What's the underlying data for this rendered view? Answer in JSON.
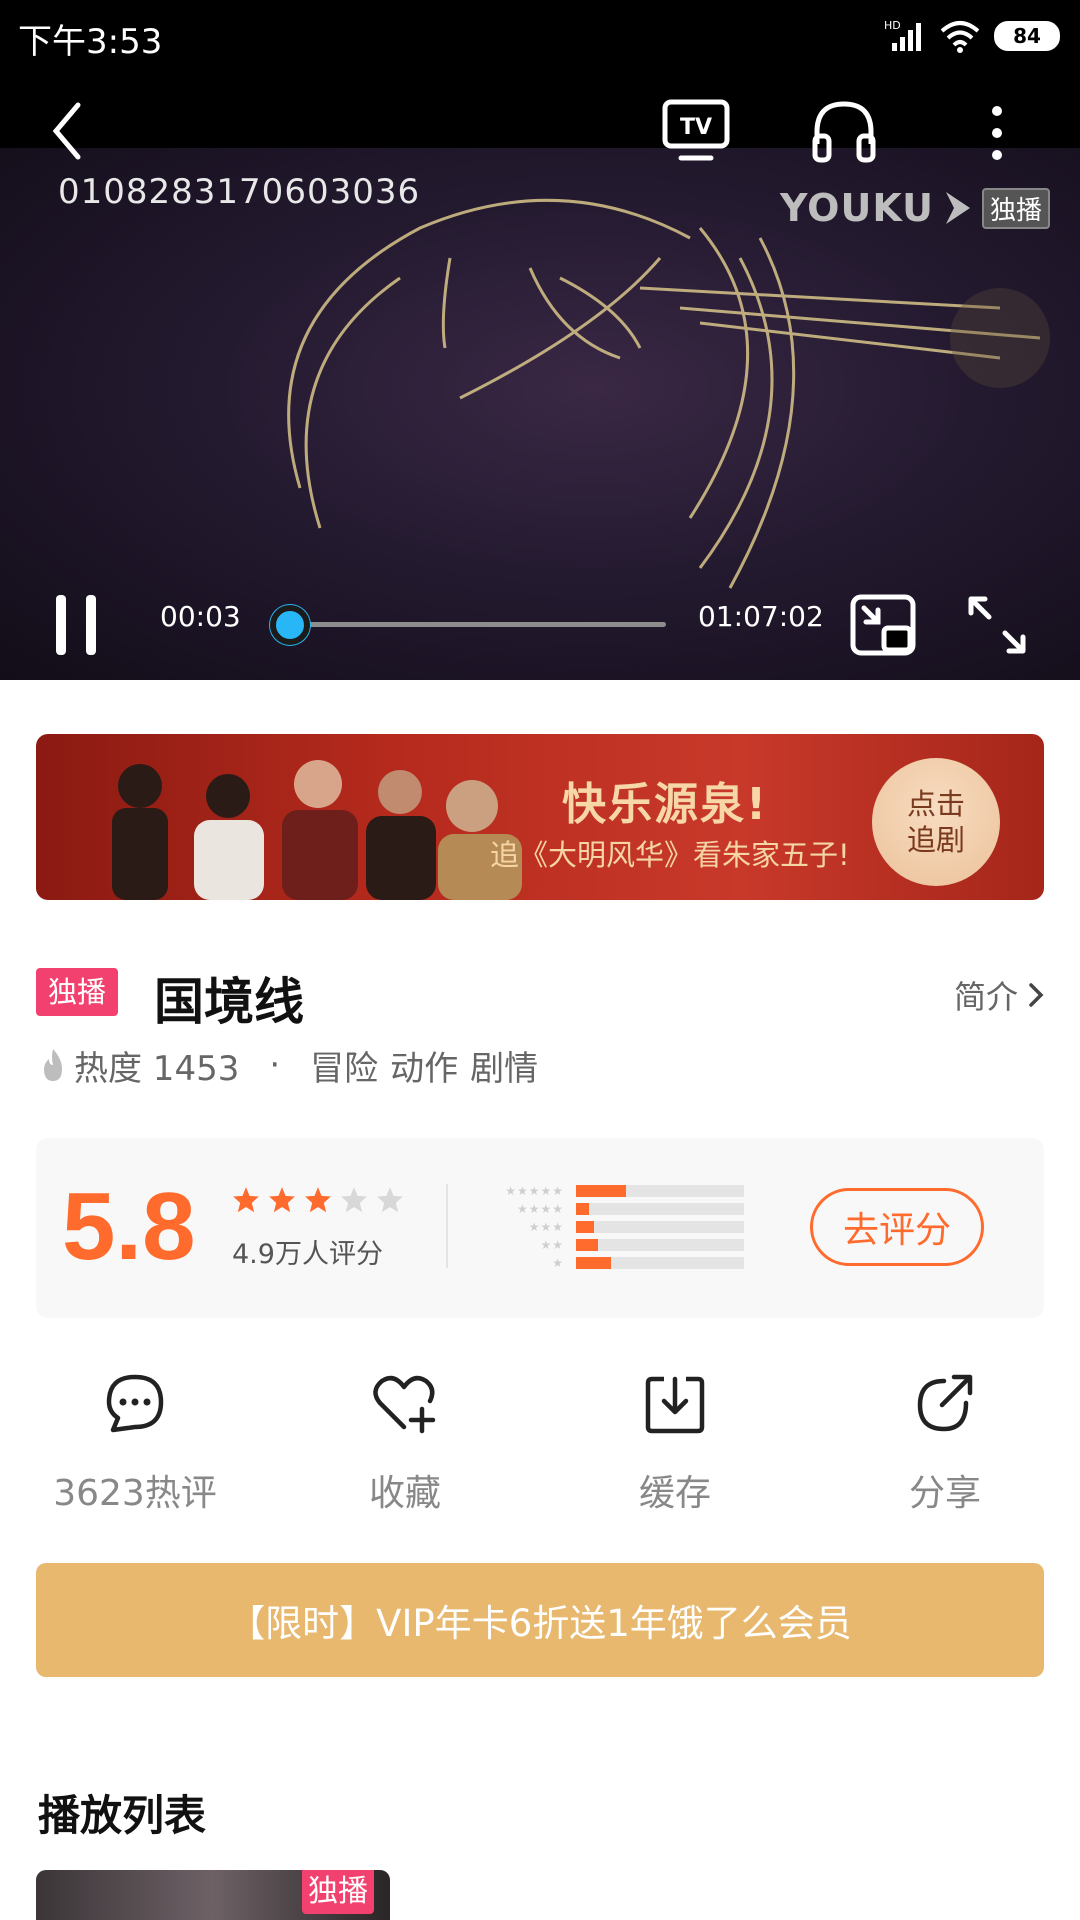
{
  "status_bar": {
    "time": "下午3:53",
    "battery": "84",
    "network_badge": "HD"
  },
  "player": {
    "video_id": "0108283170603036",
    "logo_text": "YOUKU",
    "logo_badge": "独播",
    "tv_icon_label": "TV",
    "current_time": "00:03",
    "total_time": "01:07:02",
    "progress_fraction": 0.0007,
    "state": "playing",
    "progress_color": "#29b6f6"
  },
  "banner": {
    "title": "快乐源泉!",
    "subtitle": "追《大明风华》看朱家五子!",
    "cta_line1": "点击",
    "cta_line2": "追剧"
  },
  "show": {
    "badge": "独播",
    "title": "国境线",
    "intro_label": "简介",
    "heat_label": "热度 1453",
    "separator": "·",
    "genres": [
      "冒险",
      "动作",
      "剧情"
    ]
  },
  "rating": {
    "score": "5.8",
    "stars_filled": 3,
    "stars_total": 5,
    "count_label": "4.9万人评分",
    "distribution": [
      0.3,
      0.08,
      0.11,
      0.13,
      0.21
    ],
    "rate_button": "去评分",
    "accent": "#ff6a2d"
  },
  "actions": [
    {
      "icon": "comment-icon",
      "label": "3623热评"
    },
    {
      "icon": "favorite-icon",
      "label": "收藏"
    },
    {
      "icon": "download-icon",
      "label": "缓存"
    },
    {
      "icon": "share-icon",
      "label": "分享"
    }
  ],
  "promo": {
    "text": "【限时】VIP年卡6折送1年饿了么会员",
    "color": "#e7b86d"
  },
  "playlist": {
    "title": "播放列表",
    "first_item_badge": "独播"
  }
}
